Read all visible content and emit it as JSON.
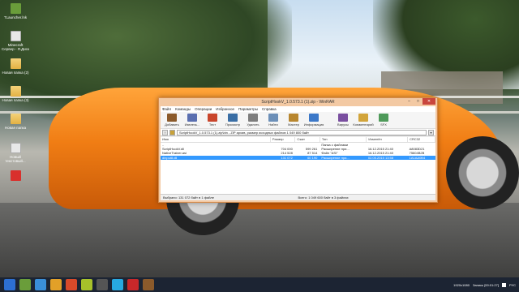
{
  "desktop": {
    "icons": [
      {
        "label": "TLauncher.lnk"
      },
      {
        "label": "Minecraft Сервер - Я.Диск"
      },
      {
        "label": "Новая папка (2)"
      },
      {
        "label": "Новая папка (3)"
      },
      {
        "label": "Новая папка"
      },
      {
        "label": "Новый текстовый..."
      }
    ]
  },
  "window": {
    "title": "ScriptHookV_1.0.573.1 (1).zip - WinRAR",
    "menu": [
      "Файл",
      "Команды",
      "Операции",
      "Избранное",
      "Параметры",
      "Справка"
    ],
    "toolbar": [
      "Добавить",
      "Извлечь...",
      "Тест",
      "Просмотр",
      "Удалить",
      "Найти",
      "Мастер",
      "Информация",
      "Вирусы",
      "Комментарий",
      "SFX"
    ],
    "path": "ScriptHookV_1.0.573.1 (1).zip\\bin - ZIP архив, размер исходных файлов 1 049 800 байт",
    "columns": [
      "Имя",
      "Размер",
      "Сжат",
      "Тип",
      "Изменён",
      "CRC32"
    ],
    "rows": [
      {
        "name": "..",
        "size": "",
        "packed": "",
        "type": "Папка с файлами",
        "modified": "",
        "crc": ""
      },
      {
        "name": "ScriptHookV.dll",
        "size": "704 000",
        "packed": "599 261",
        "type": "Расширение при...",
        "modified": "16.12.2015 21:40",
        "crc": "A8083D21"
      },
      {
        "name": "NativeTrainer.asi",
        "size": "214 528",
        "packed": "87 514",
        "type": "Файл \"ASI\"",
        "modified": "16.12.2015 21:40",
        "crc": "75604B2B"
      },
      {
        "name": "dinput8.dll",
        "size": "131 072",
        "packed": "60 190",
        "type": "Расширение при...",
        "modified": "02.05.2015 13:58",
        "crc": "1A1AA0B4"
      }
    ],
    "status_left": "Выбрано: 131 072 байт в 1 файле",
    "status_right": "Всего: 1 049 600 байт в 3 файлах"
  },
  "taskbar": {
    "resolution": "1920x1080",
    "time_label": "Запись [00:01:27]",
    "lang": "РУС"
  }
}
